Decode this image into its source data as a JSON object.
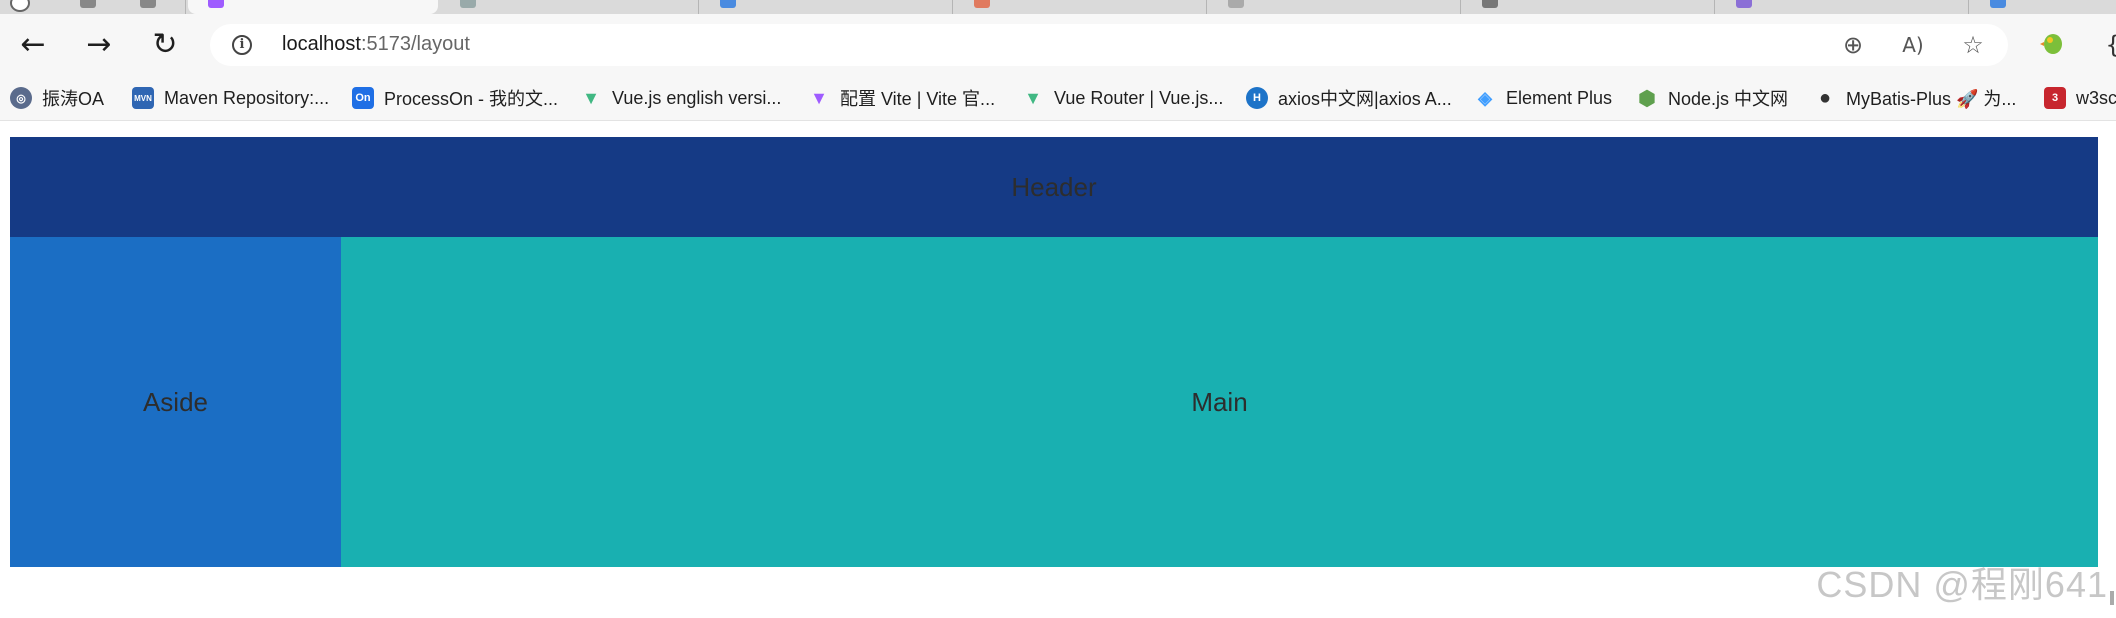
{
  "browser": {
    "nav": {
      "back_glyph": "←",
      "forward_glyph": "→",
      "reload_glyph": "↻"
    },
    "address": {
      "info_glyph": "i",
      "host": "localhost",
      "path": ":5173/layout"
    },
    "omnibox_icons": {
      "zoom": "⊕",
      "read_aloud": "A)",
      "favorite": "☆"
    }
  },
  "bookmarks": [
    {
      "label": "振涛OA",
      "icon": "circle-logo-icon",
      "color": "#5a6b8c",
      "glyph": "◎"
    },
    {
      "label": "Maven Repository:...",
      "icon": "mvn-icon",
      "color": "#2f66b3",
      "glyph": "MVN"
    },
    {
      "label": "ProcessOn - 我的文...",
      "icon": "processon-icon",
      "color": "#1f6fe5",
      "glyph": "On"
    },
    {
      "label": "Vue.js english  versi...",
      "icon": "vue-icon",
      "color": "#41b883",
      "glyph": "▼"
    },
    {
      "label": "配置 Vite | Vite 官...",
      "icon": "vite-icon",
      "color": "#9f5cff",
      "glyph": "▼"
    },
    {
      "label": "Vue Router | Vue.js...",
      "icon": "vue-router-icon",
      "color": "#41b883",
      "glyph": "▼"
    },
    {
      "label": "axios中文网|axios A...",
      "icon": "axios-icon",
      "color": "#1d73c8",
      "glyph": "H"
    },
    {
      "label": "Element Plus",
      "icon": "element-plus-icon",
      "color": "#409eff",
      "glyph": "◈"
    },
    {
      "label": "Node.js 中文网",
      "icon": "nodejs-icon",
      "color": "#5fa04e",
      "glyph": "⬢"
    },
    {
      "label": "MyBatis-Plus 🚀 为...",
      "icon": "mybatis-plus-icon",
      "color": "#333333",
      "glyph": "●"
    },
    {
      "label": "w3sc",
      "icon": "w3school-icon",
      "color": "#c7262e",
      "glyph": "3"
    }
  ],
  "page": {
    "header_text": "Header",
    "aside_text": "Aside",
    "main_text": "Main",
    "colors": {
      "header": "#153a85",
      "aside": "#1b6ec4",
      "main": "#19b0b1"
    }
  },
  "watermark": "CSDN @程刚641"
}
